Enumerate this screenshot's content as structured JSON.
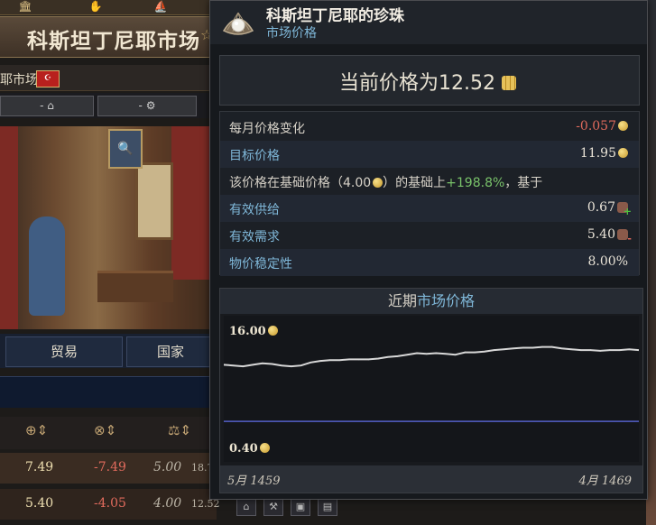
{
  "market_panel": {
    "title": "科斯坦丁尼耶市场",
    "subtitle": "耶市场",
    "flag_symbol": "☪",
    "controls": [
      "-",
      "-"
    ],
    "tabs": [
      "贸易",
      "国家"
    ],
    "rows": [
      {
        "c1": "7.49",
        "c2": "-7.49",
        "c3": "5.00",
        "c4": "18.7"
      },
      {
        "c1": "5.40",
        "c2": "-4.05",
        "c3": "4.00",
        "c4": "12.52"
      }
    ],
    "colors": {
      "positive": "#eedfb0",
      "negative": "#e06a5c",
      "muted": "#b9b2a4"
    }
  },
  "tooltip": {
    "title": "科斯坦丁尼耶的珍珠",
    "subtitle": "市场价格",
    "current_price_label": "当前价格为12.52",
    "stats": {
      "monthly_change": {
        "label": "每月价格变化",
        "value": "-0.057"
      },
      "target_price": {
        "label": "目标价格",
        "value": "11.95"
      },
      "base_note": {
        "prefix": "该价格在基础价格（4.00",
        "mid": "）的基础上",
        "pct": "+198.8%",
        "suffix": "，基于"
      },
      "effective_supply": {
        "label": "有效供给",
        "value": "0.67"
      },
      "effective_demand": {
        "label": "有效需求",
        "value": "5.40"
      },
      "price_stability": {
        "label": "物价稳定性",
        "value": "8.00%"
      }
    }
  },
  "chart_data": {
    "type": "line",
    "title_part1": "近期",
    "title_part2": "市场价格",
    "y_max_label": "16.00",
    "y_min_label": "0.40",
    "x_start_label": "5月 1459",
    "x_end_label": "4月 1469",
    "ylim": [
      0.4,
      16.0
    ],
    "series": [
      {
        "values": [
          11.3,
          11.2,
          11.1,
          11.3,
          11.5,
          11.4,
          11.2,
          11.1,
          11.2,
          11.6,
          11.8,
          11.9,
          11.9,
          12.0,
          12.0,
          12.0,
          12.1,
          12.3,
          12.4,
          12.6,
          12.8,
          12.7,
          12.8,
          12.7,
          12.6,
          12.9,
          12.9,
          13.0,
          13.2,
          13.3,
          13.4,
          13.5,
          13.5,
          13.6,
          13.6,
          13.4,
          13.3,
          13.2,
          13.2,
          13.1,
          13.2,
          13.2,
          13.3,
          13.2
        ]
      }
    ],
    "reference_line": {
      "value": 4.0,
      "color": "#5560c8"
    },
    "line_color": "#d8d8d8"
  }
}
